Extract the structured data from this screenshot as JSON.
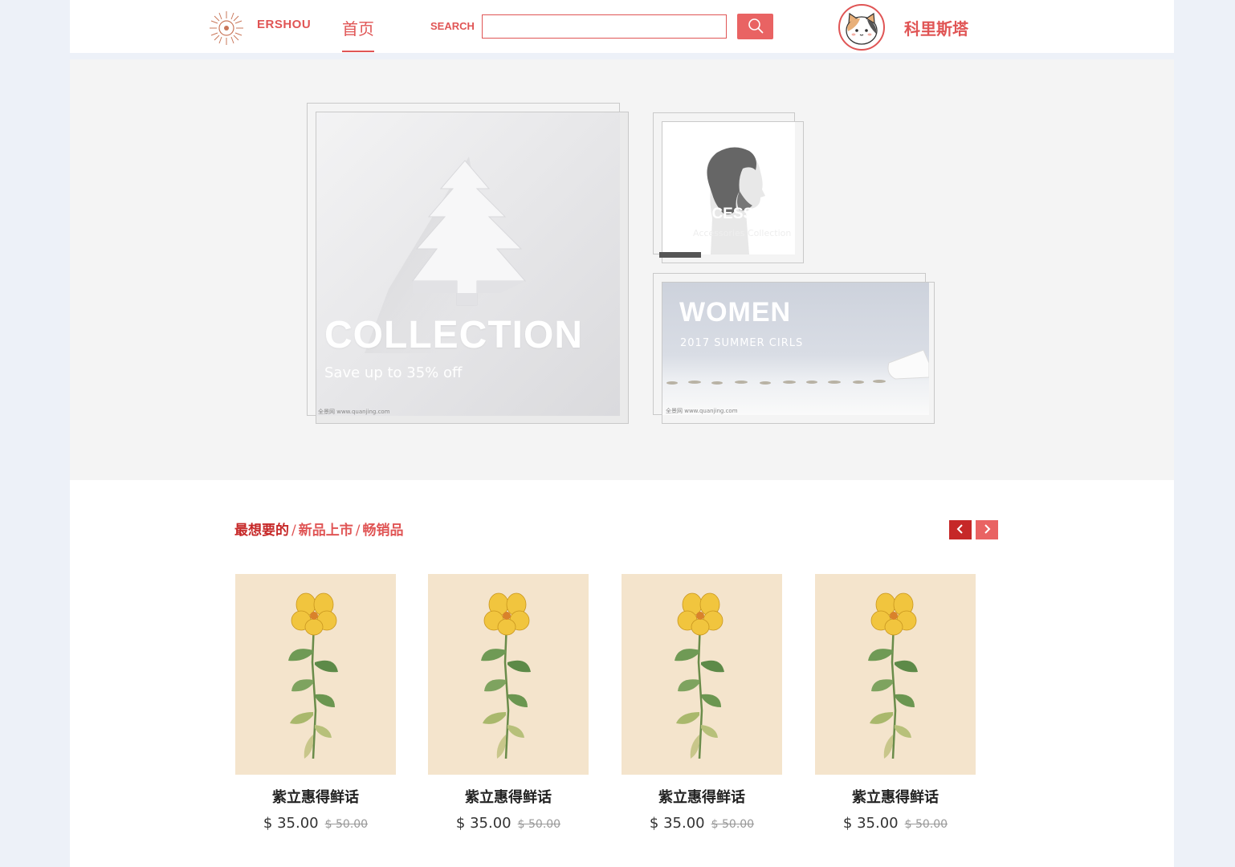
{
  "header": {
    "brand": "ERSHOU",
    "nav_home": "首页",
    "search_label": "SEARCH",
    "search_placeholder": "",
    "username": "科里斯塔"
  },
  "banner": {
    "collection": {
      "title": "COLLECTION",
      "subtitle": "Save up to 35% off",
      "watermark": "全景网 www.quanjing.com"
    },
    "accessories": {
      "title": "ACCESSORIES",
      "subtitle": "Accessories Collection"
    },
    "women": {
      "title": "WOMEN",
      "subtitle": "2017 SUMMER CIRLS",
      "watermark": "全景网 www.quanjing.com"
    }
  },
  "products": {
    "tabs": {
      "tab1": "最想要的",
      "tab2": "新品上市",
      "tab3": "畅销品",
      "separator": "/"
    },
    "items": [
      {
        "name": "紫立惠得鲜话",
        "price": "$ 35.00",
        "old_price": "$ 50.00"
      },
      {
        "name": "紫立惠得鲜话",
        "price": "$ 35.00",
        "old_price": "$ 50.00"
      },
      {
        "name": "紫立惠得鲜话",
        "price": "$ 35.00",
        "old_price": "$ 50.00"
      },
      {
        "name": "紫立惠得鲜话",
        "price": "$ 35.00",
        "old_price": "$ 50.00"
      }
    ]
  },
  "colors": {
    "accent": "#e05555",
    "accent_dark": "#c62828",
    "button": "#e96363",
    "page_bg": "#edf1f8",
    "banner_bg": "#f4f4f4"
  },
  "icons": {
    "logo": "sunburst-logo-icon",
    "search": "search-icon",
    "prev": "chevron-left-icon",
    "next": "chevron-right-icon"
  }
}
